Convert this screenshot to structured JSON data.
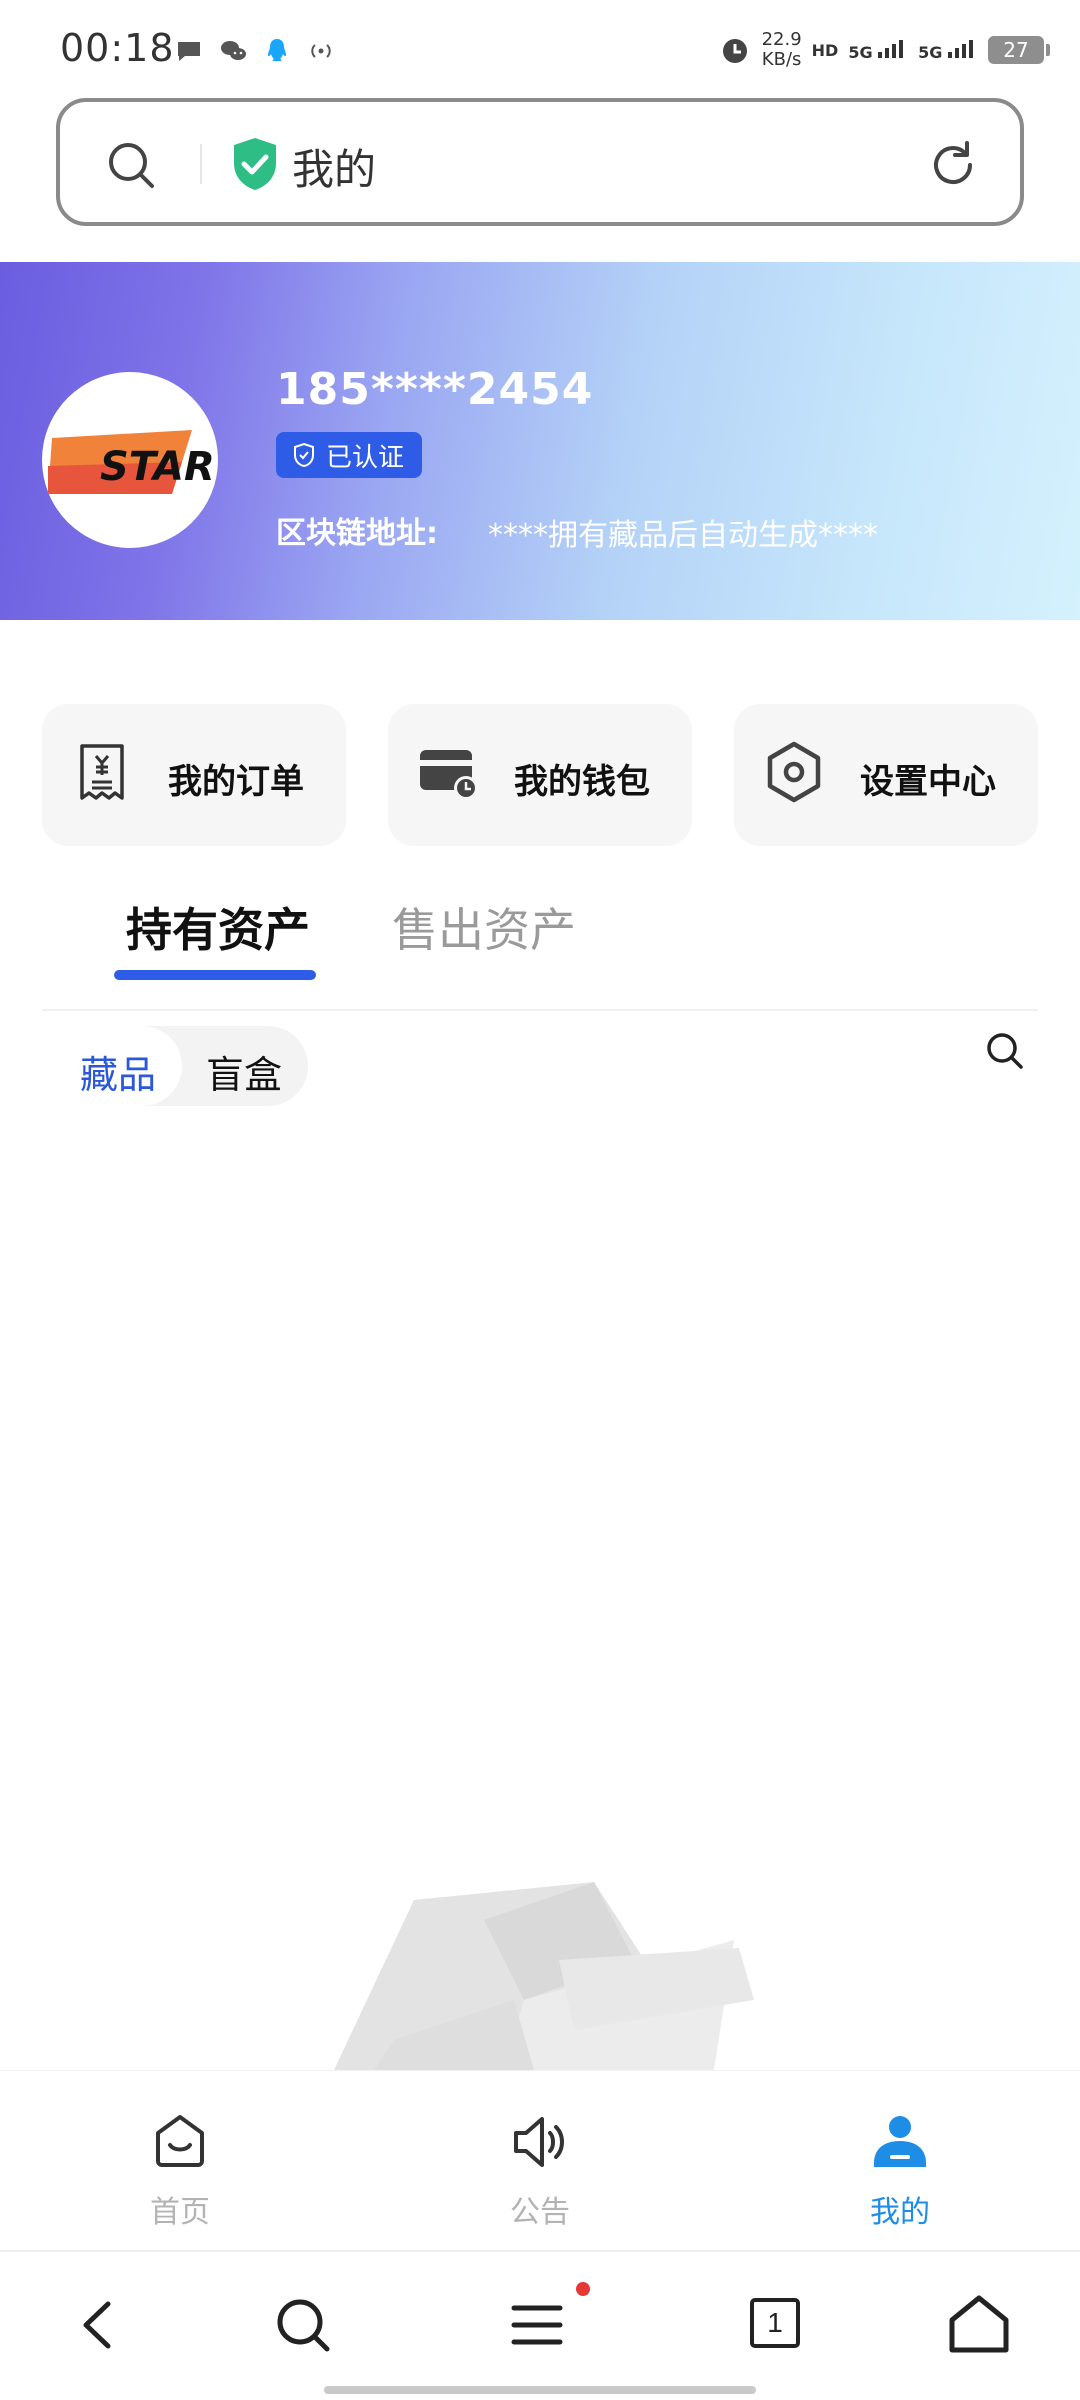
{
  "status_bar": {
    "time": "00:18",
    "net_speed_value": "22.9",
    "net_speed_unit": "KB/s",
    "hd_badge": "HD",
    "sim1": "5G",
    "sim2": "5G",
    "battery": "27"
  },
  "address_bar": {
    "title": "我的"
  },
  "profile": {
    "phone": "185****2454",
    "verified_label": "已认证",
    "chain_address_label": "区块链地址:",
    "chain_address_value": "****拥有藏品后自动生成****",
    "avatar_logo_text": "STAR"
  },
  "quick_actions": [
    {
      "label": "我的订单",
      "icon": "receipt-icon"
    },
    {
      "label": "我的钱包",
      "icon": "wallet-icon"
    },
    {
      "label": "设置中心",
      "icon": "settings-icon"
    }
  ],
  "asset_tabs": [
    {
      "label": "持有资产",
      "active": true
    },
    {
      "label": "售出资产",
      "active": false
    }
  ],
  "asset_segment": [
    {
      "label": "藏品",
      "active": true
    },
    {
      "label": "盲盒",
      "active": false
    }
  ],
  "bottom_nav": [
    {
      "label": "首页",
      "icon": "home-icon",
      "active": false
    },
    {
      "label": "公告",
      "icon": "speaker-icon",
      "active": false
    },
    {
      "label": "我的",
      "icon": "person-icon",
      "active": true
    }
  ],
  "browser_toolbar": {
    "tab_count": "1"
  },
  "colors": {
    "accent_blue": "#2f5ce6",
    "nav_active": "#1e8de6",
    "inactive_gray": "#b3b3b3"
  }
}
